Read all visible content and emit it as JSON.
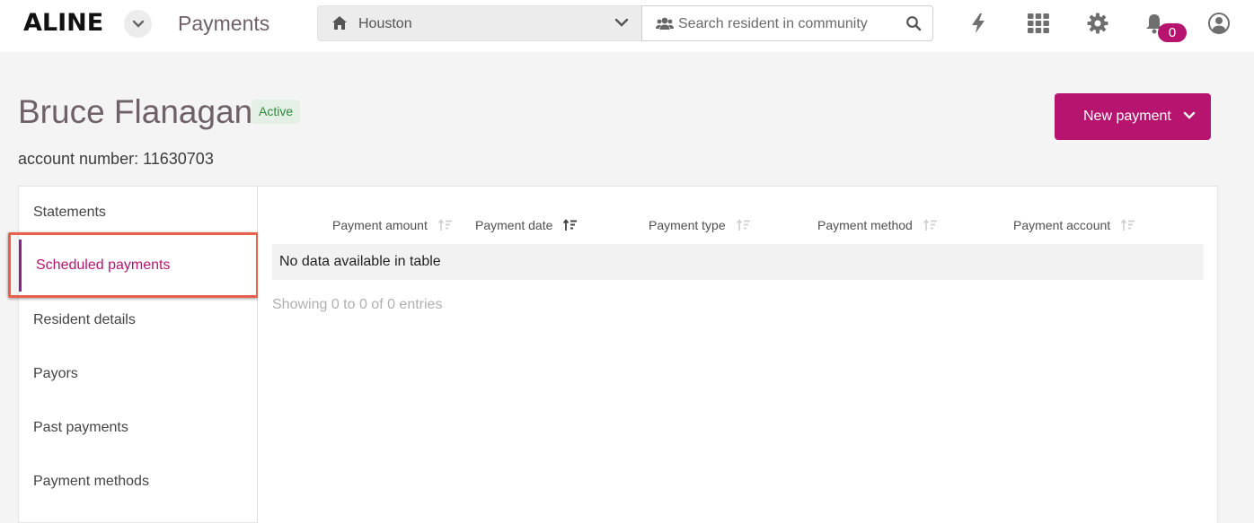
{
  "topbar": {
    "logo": "ALINE",
    "page_title": "Payments",
    "community": "Houston",
    "search_placeholder": "Search resident in community",
    "notification_count": "0"
  },
  "resident": {
    "name": "Bruce Flanagan",
    "status": "Active",
    "account_line": "account number: 11630703"
  },
  "actions": {
    "new_payment_label": "New payment"
  },
  "sidenav": {
    "items": [
      {
        "label": "Statements"
      },
      {
        "label": "Scheduled payments"
      },
      {
        "label": "Resident details"
      },
      {
        "label": "Payors"
      },
      {
        "label": "Past payments"
      },
      {
        "label": "Payment methods"
      }
    ],
    "active_index": 1
  },
  "table": {
    "columns": [
      "Payment amount",
      "Payment date",
      "Payment type",
      "Payment method",
      "Payment account"
    ],
    "sorted_column": "Payment date",
    "empty_message": "No data available in table",
    "info": "Showing 0 to 0 of 0 entries"
  },
  "colors": {
    "accent": "#b6146f",
    "highlight_outline": "#e8604c",
    "status_green": "#2f8a3c"
  }
}
